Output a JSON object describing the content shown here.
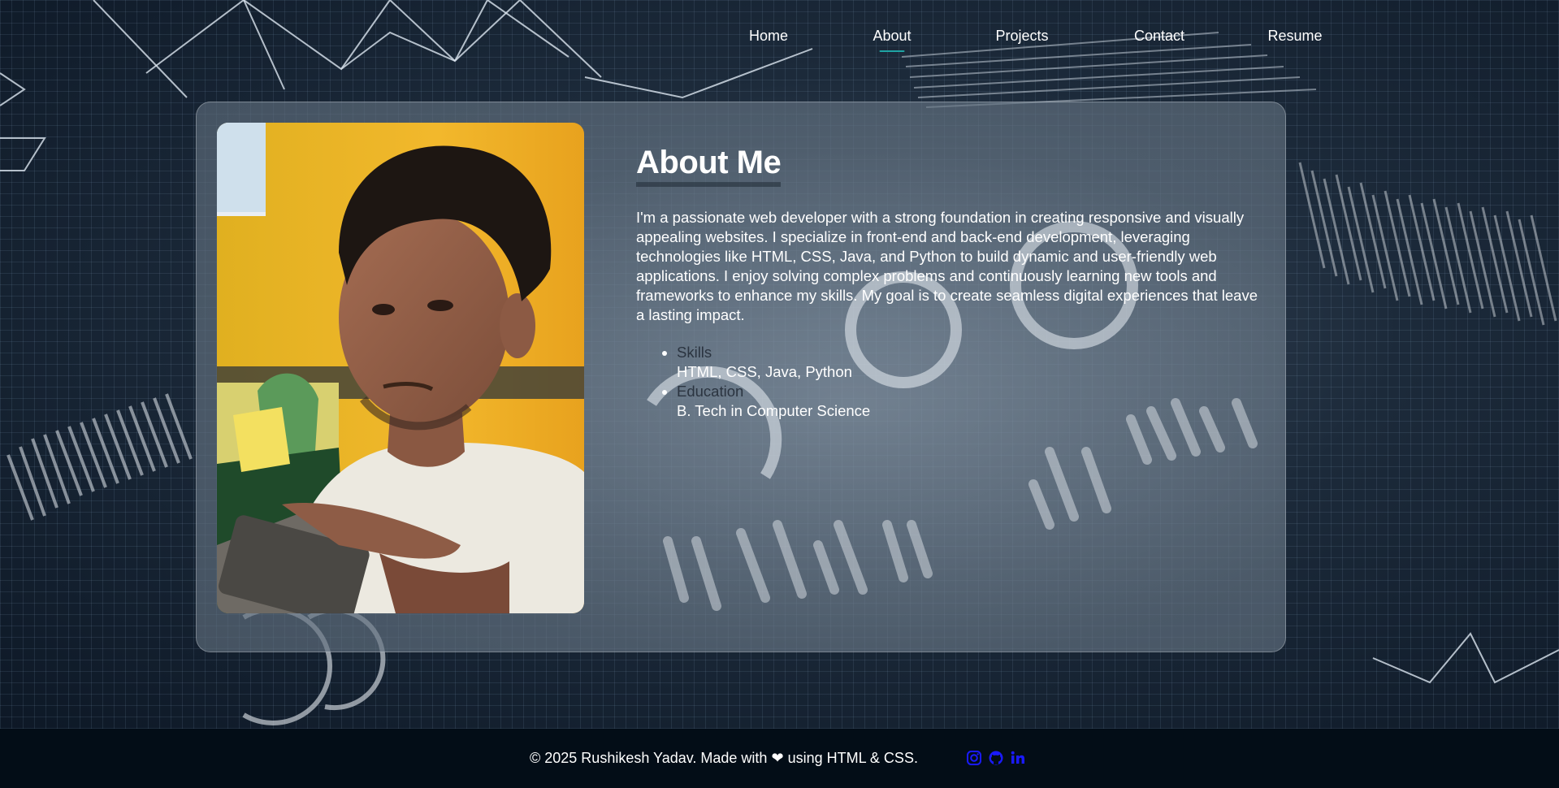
{
  "nav": {
    "items": [
      {
        "label": "Home",
        "active": false
      },
      {
        "label": "About",
        "active": true
      },
      {
        "label": "Projects",
        "active": false
      },
      {
        "label": "Contact",
        "active": false
      },
      {
        "label": "Resume",
        "active": false
      }
    ],
    "active_underline_color": "#1fa4a4"
  },
  "about": {
    "title": "About Me",
    "paragraph": "I'm a passionate web developer with a strong foundation in creating responsive and visually appealing websites. I specialize in front-end and back-end development, leveraging technologies like HTML, CSS, Java, and Python to build dynamic and user-friendly web applications. I enjoy solving complex problems and continuously learning new tools and frameworks to enhance my skills. My goal is to create seamless digital experiences that leave a lasting impact.",
    "details": [
      {
        "term": "Skills",
        "value": "HTML, CSS, Java, Python"
      },
      {
        "term": "Education",
        "value": "B. Tech in Computer Science"
      }
    ],
    "photo_icon": "profile-photo"
  },
  "footer": {
    "text_before_heart": "© 2025 Rushikesh Yadav. Made with",
    "heart_icon": "heart-icon",
    "text_after_heart": "using HTML & CSS.",
    "social_icons": [
      "instagram-icon",
      "github-icon",
      "linkedin-icon"
    ],
    "social_color": "#1a1aff"
  }
}
